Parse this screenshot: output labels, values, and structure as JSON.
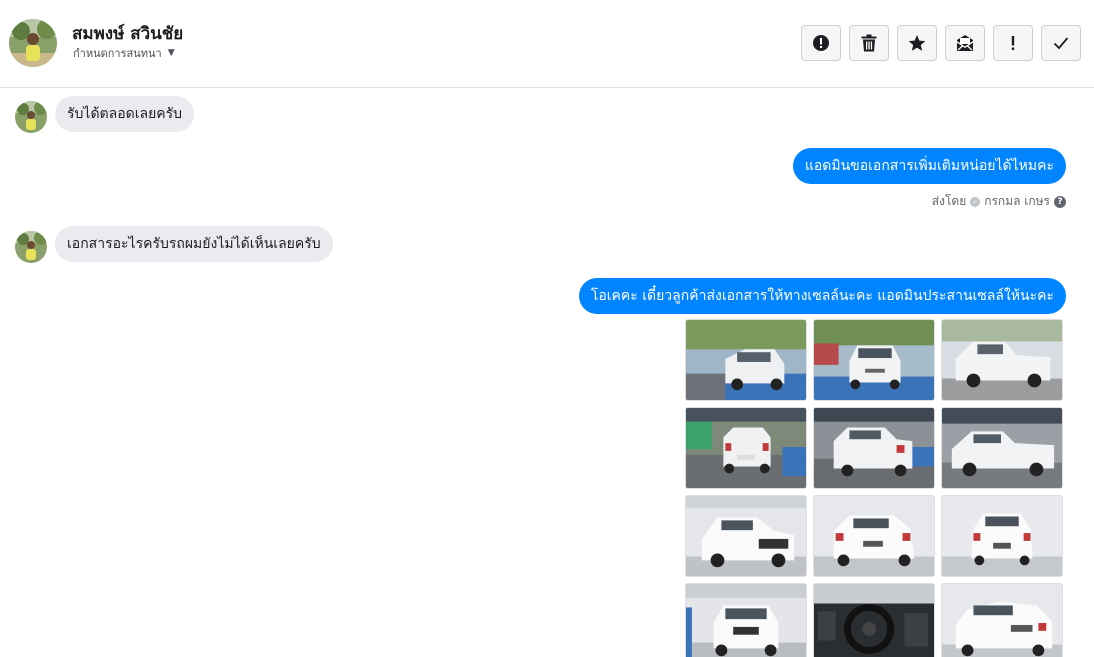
{
  "contact": {
    "name": "สมพงษ์ สวินชัย",
    "subtitle": "กำหนดการสนทนา"
  },
  "toolbar": {
    "buttons": [
      {
        "icon": "alert-circle-icon",
        "label": "report"
      },
      {
        "icon": "trash-icon",
        "label": "delete"
      },
      {
        "icon": "star-icon",
        "label": "star"
      },
      {
        "icon": "mark-unread-icon",
        "label": "mark unread"
      },
      {
        "icon": "exclamation-icon",
        "label": "important"
      },
      {
        "icon": "check-icon",
        "label": "done"
      }
    ]
  },
  "messages": [
    {
      "direction": "in",
      "text": "รับได้ตลอดเลยครับ"
    },
    {
      "direction": "out",
      "text": "แอดมินขอเอกสารเพิ่มเติมหน่อยได้ไหมคะ"
    },
    {
      "direction": "in",
      "text": "เอกสารอะไรครับรถผมยังไม่ได้เห็นเลยครับ"
    },
    {
      "direction": "out",
      "text": "โอเคคะ เดี๋ยวลูกค้าส่งเอกสารให้ทางเซลล์นะคะ แอดมินประสานเซลล์ให้นะคะ"
    }
  ],
  "sent_by": {
    "prefix": "ส่งโดย",
    "name": "กรกมล เกษร",
    "help": "?"
  },
  "photos": {
    "count_visible": 12,
    "subject": "white pickup truck"
  },
  "colors": {
    "outgoing_bubble": "#0084ff",
    "incoming_bubble": "#e9ebee",
    "icon": "#1c1e21"
  }
}
